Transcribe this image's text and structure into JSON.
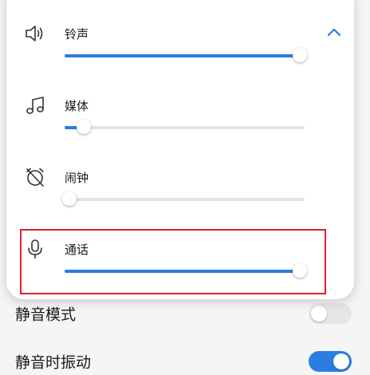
{
  "colors": {
    "accent": "#2a7de1",
    "highlight": "#d8212e"
  },
  "volume_panel": {
    "collapse_icon": "chevron-up-icon",
    "sliders": [
      {
        "label": "铃声",
        "icon": "speaker-icon",
        "level": 0.98
      },
      {
        "label": "媒体",
        "icon": "music-note-icon",
        "level": 0.08
      },
      {
        "label": "闹钟",
        "icon": "alarm-off-icon",
        "level": 0.02
      },
      {
        "label": "通话",
        "icon": "microphone-icon",
        "level": 0.98
      }
    ]
  },
  "settings": {
    "silent_mode": {
      "label": "静音模式",
      "on": false
    },
    "vibrate_on_silent": {
      "label": "静音时振动",
      "on": true
    }
  }
}
